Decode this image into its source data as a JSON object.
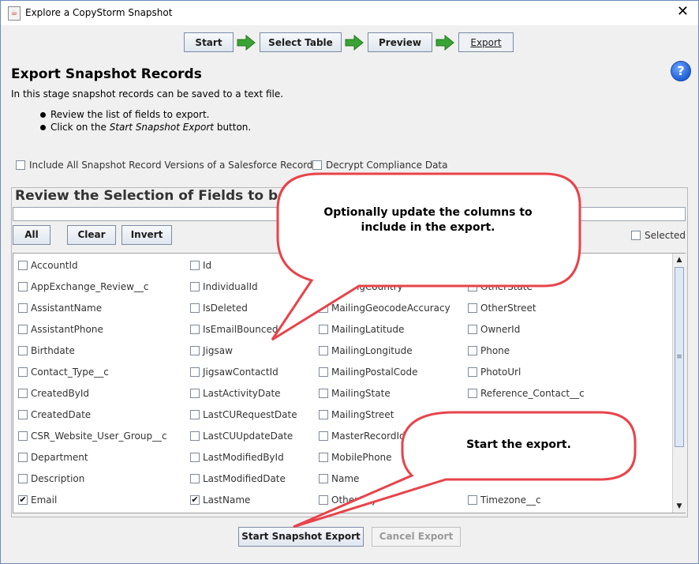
{
  "window": {
    "title": "Explore a CopyStorm Snapshot",
    "close_glyph": "✕"
  },
  "wizard": {
    "steps": [
      {
        "label": "Start"
      },
      {
        "label": "Select Table"
      },
      {
        "label": "Preview"
      },
      {
        "label": "Export",
        "active": true
      }
    ]
  },
  "header": {
    "title": "Export Snapshot Records",
    "description": "In this stage snapshot records can be saved to a text file.",
    "bullet1": "Review the list of fields to export.",
    "bullet2_prefix": "Click on the ",
    "bullet2_italic": "Start Snapshot Export",
    "bullet2_suffix": " button."
  },
  "options": {
    "include_all_versions": {
      "label": "Include All Snapshot Record Versions of a Salesforce Record",
      "checked": false
    },
    "decrypt_compliance": {
      "label": "Decrypt Compliance Data",
      "checked": false
    }
  },
  "fields_section": {
    "title": "Review the Selection of Fields to be Inc",
    "search_value": "",
    "buttons": {
      "all": "All",
      "clear": "Clear",
      "invert": "Invert"
    },
    "selected_filter": {
      "label": "Selected",
      "checked": false
    }
  },
  "field_columns": [
    [
      {
        "label": "AccountId",
        "checked": false
      },
      {
        "label": "AppExchange_Review__c",
        "checked": false
      },
      {
        "label": "AssistantName",
        "checked": false
      },
      {
        "label": "AssistantPhone",
        "checked": false
      },
      {
        "label": "Birthdate",
        "checked": false
      },
      {
        "label": "Contact_Type__c",
        "checked": false
      },
      {
        "label": "CreatedById",
        "checked": false
      },
      {
        "label": "CreatedDate",
        "checked": false
      },
      {
        "label": "CSR_Website_User_Group__c",
        "checked": false
      },
      {
        "label": "Department",
        "checked": false
      },
      {
        "label": "Description",
        "checked": false
      },
      {
        "label": "Email",
        "checked": true
      }
    ],
    [
      {
        "label": "Id",
        "checked": false
      },
      {
        "label": "IndividualId",
        "checked": false
      },
      {
        "label": "IsDeleted",
        "checked": false
      },
      {
        "label": "IsEmailBounced",
        "checked": false
      },
      {
        "label": "Jigsaw",
        "checked": false
      },
      {
        "label": "JigsawContactId",
        "checked": false
      },
      {
        "label": "LastActivityDate",
        "checked": false
      },
      {
        "label": "LastCURequestDate",
        "checked": false
      },
      {
        "label": "LastCUUpdateDate",
        "checked": false
      },
      {
        "label": "LastModifiedById",
        "checked": false
      },
      {
        "label": "LastModifiedDate",
        "checked": false
      },
      {
        "label": "LastName",
        "checked": true
      }
    ],
    [
      {
        "label": "",
        "checked": false,
        "hidden": true
      },
      {
        "label": "MailingCountry",
        "checked": false,
        "hide_box": true
      },
      {
        "label": "MailingGeocodeAccuracy",
        "checked": false
      },
      {
        "label": "MailingLatitude",
        "checked": false
      },
      {
        "label": "MailingLongitude",
        "checked": false
      },
      {
        "label": "MailingPostalCode",
        "checked": false
      },
      {
        "label": "MailingState",
        "checked": false
      },
      {
        "label": "MailingStreet",
        "checked": false
      },
      {
        "label": "MasterRecordId",
        "checked": false
      },
      {
        "label": "MobilePhone",
        "checked": false
      },
      {
        "label": "Name",
        "checked": false
      },
      {
        "label": "OtherCity",
        "checked": false
      }
    ],
    [
      {
        "label": "",
        "checked": false,
        "hidden": true
      },
      {
        "label": "OtherState",
        "checked": false
      },
      {
        "label": "OtherStreet",
        "checked": false
      },
      {
        "label": "OwnerId",
        "checked": false
      },
      {
        "label": "Phone",
        "checked": false
      },
      {
        "label": "PhotoUrl",
        "checked": false
      },
      {
        "label": "Reference_Contact__c",
        "checked": false
      },
      {
        "label": "",
        "checked": false,
        "hidden": true
      },
      {
        "label": "",
        "checked": false,
        "hidden": true
      },
      {
        "label": "",
        "checked": false,
        "hidden": true
      },
      {
        "label": "",
        "checked": false,
        "hidden": true
      },
      {
        "label": "Timezone__c",
        "checked": false
      }
    ]
  ],
  "actions": {
    "start_label": "Start Snapshot Export",
    "cancel_label": "Cancel Export"
  },
  "callouts": {
    "top": "Optionally update the columns to include in the export.",
    "bottom": "Start the export."
  },
  "colors": {
    "callout_border": "#e8434a",
    "arrow_green": "#3aa335",
    "accent_blue": "#1f5fd6"
  }
}
